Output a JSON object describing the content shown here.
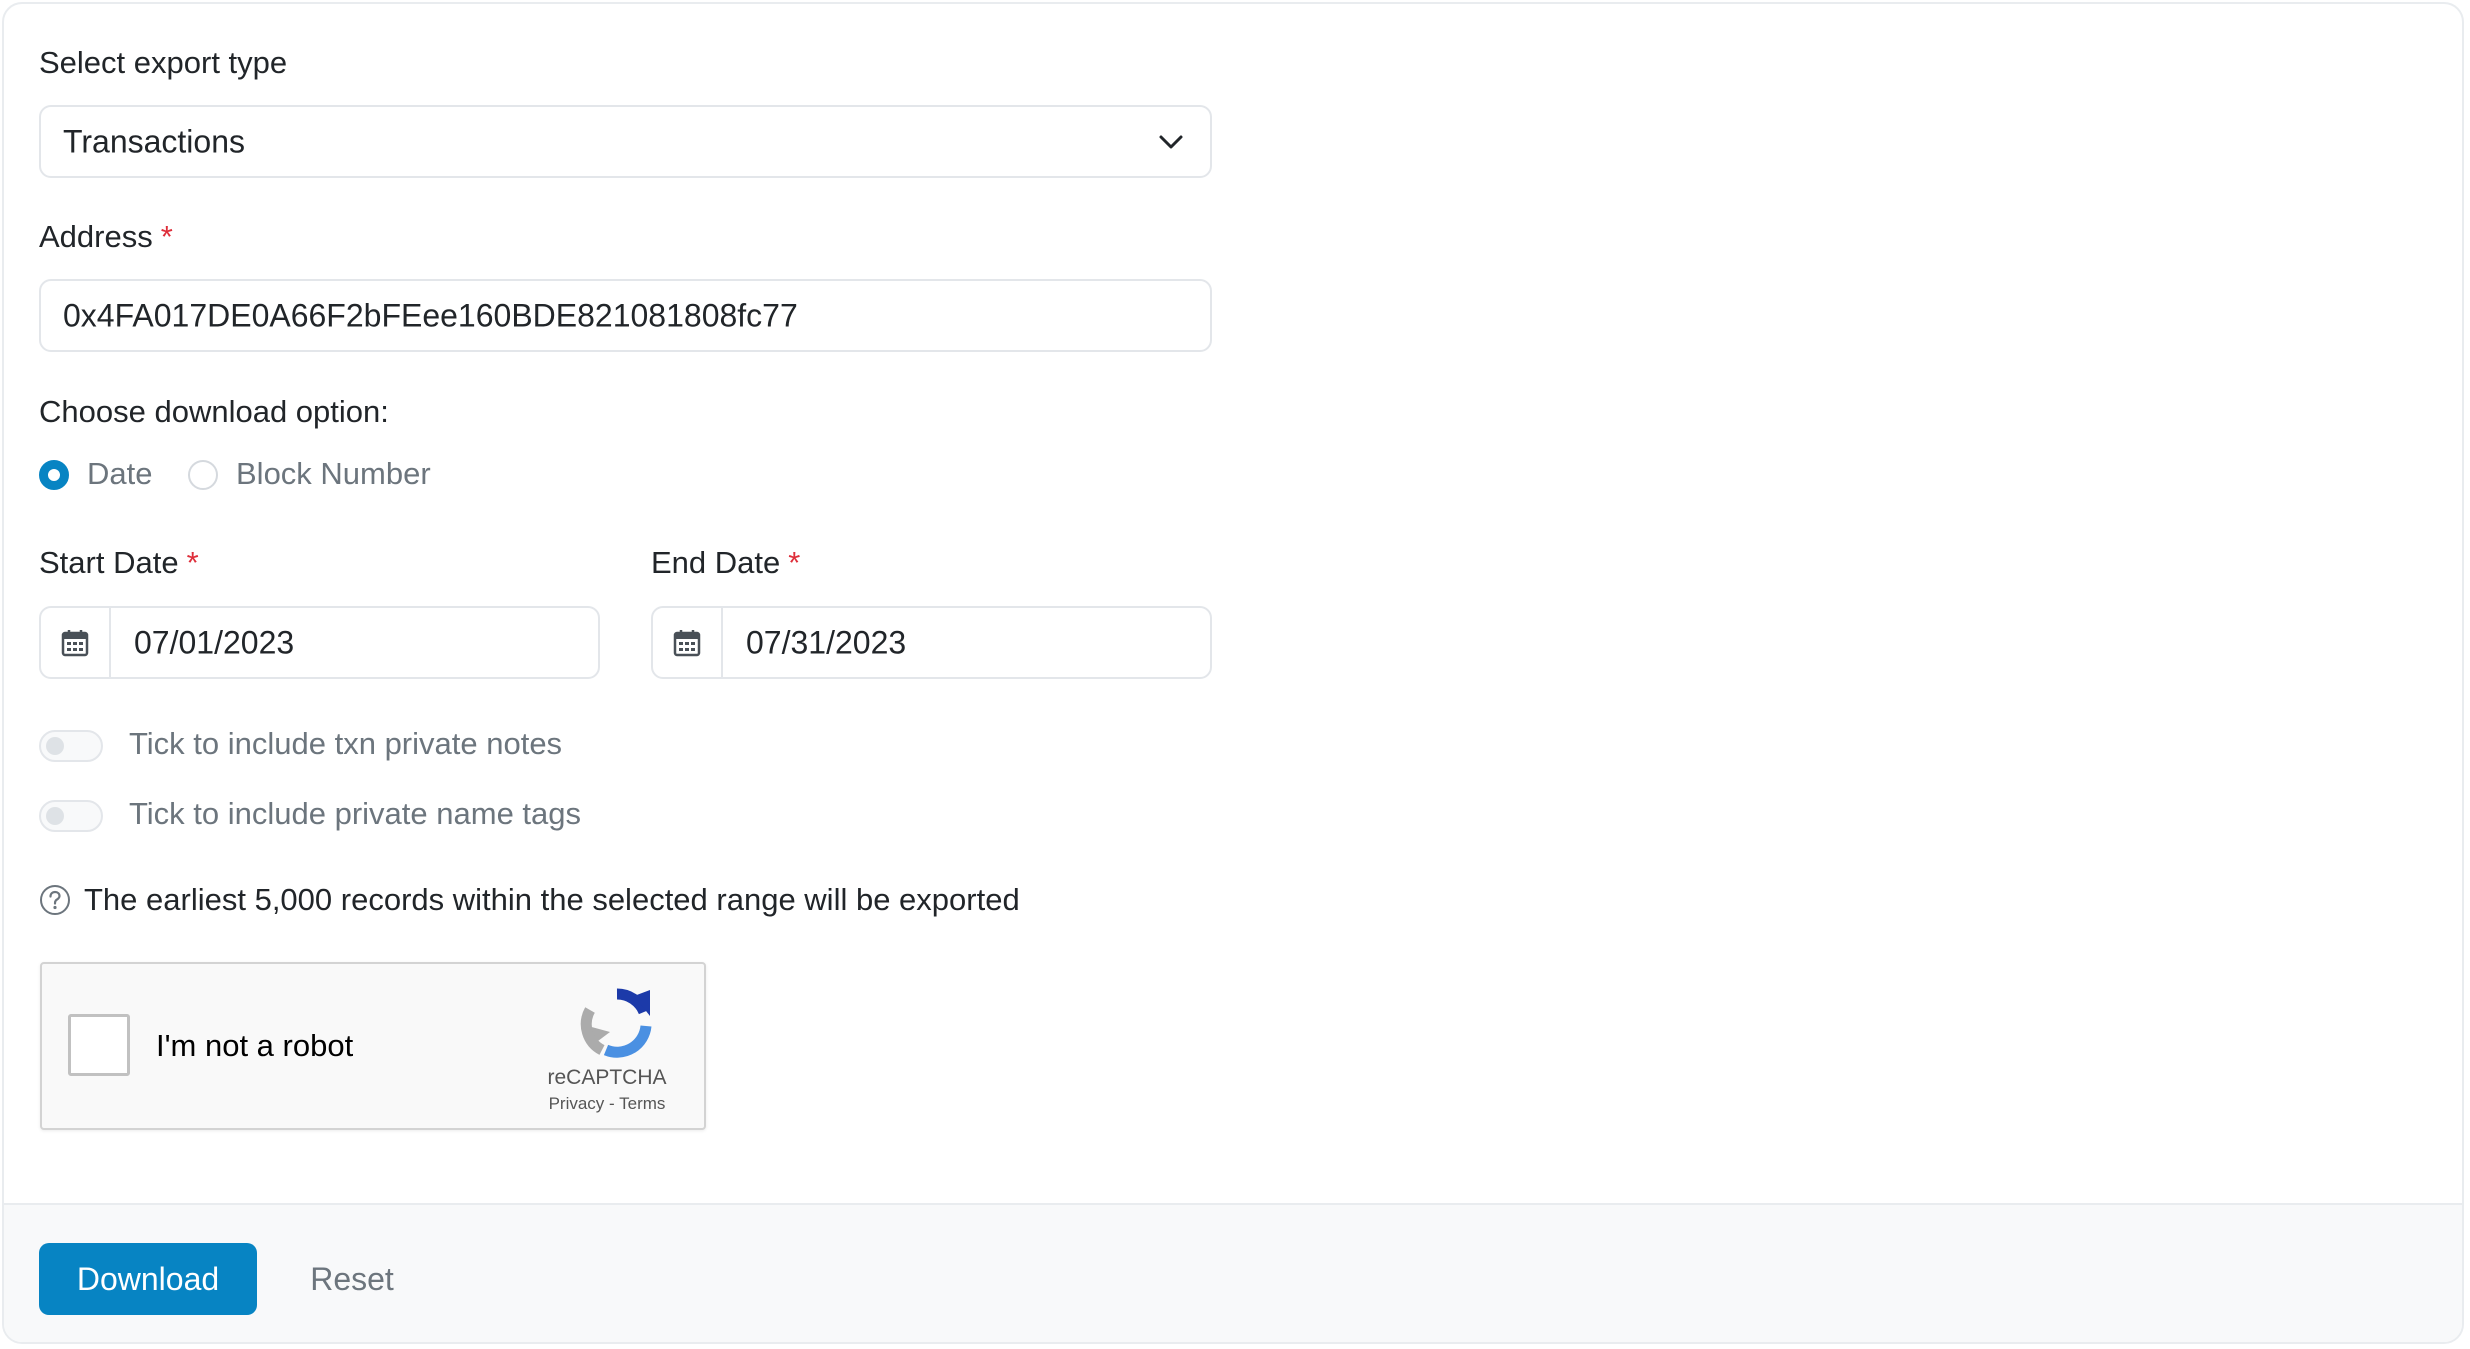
{
  "export_type": {
    "label": "Select export type",
    "selected": "Transactions"
  },
  "address": {
    "label": "Address",
    "required_marker": "*",
    "value": "0x4FA017DE0A66F2bFEee160BDE821081808fc77"
  },
  "download_option": {
    "label": "Choose download option:",
    "options": [
      {
        "label": "Date",
        "selected": true
      },
      {
        "label": "Block Number",
        "selected": false
      }
    ]
  },
  "start_date": {
    "label": "Start Date",
    "required_marker": "*",
    "value": "07/01/2023"
  },
  "end_date": {
    "label": "End Date",
    "required_marker": "*",
    "value": "07/31/2023"
  },
  "toggles": [
    {
      "label": "Tick to include txn private notes",
      "on": false
    },
    {
      "label": "Tick to include private name tags",
      "on": false
    }
  ],
  "info": {
    "text": "The earliest 5,000 records within the selected range will be exported",
    "icon": "question-circle-icon"
  },
  "recaptcha": {
    "text": "I'm not a robot",
    "brand": "reCAPTCHA",
    "privacy": "Privacy",
    "separator": "-",
    "terms": "Terms"
  },
  "footer": {
    "download_label": "Download",
    "reset_label": "Reset"
  },
  "colors": {
    "primary": "#0784c3",
    "required": "#de2e3a",
    "muted_text": "#6c757d",
    "border": "#e3e6ea",
    "footer_bg": "#f8f9fa"
  }
}
